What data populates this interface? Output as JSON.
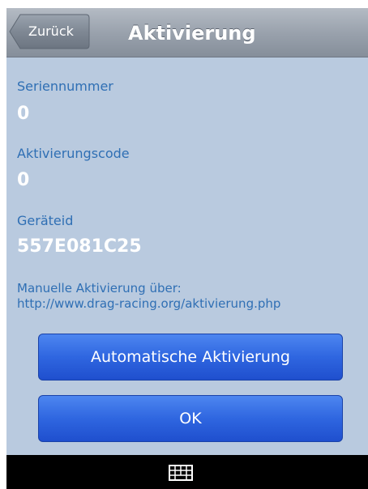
{
  "navbar": {
    "back_label": "Zurück",
    "title": "Aktivierung"
  },
  "fields": {
    "serial_label": "Seriennummer",
    "serial_value": "0",
    "activation_label": "Aktivierungscode",
    "activation_value": "0",
    "device_label": "Geräteid",
    "device_value": "557E081C25"
  },
  "info": {
    "line1": "Manuelle Aktivierung über:",
    "line2": "http://www.drag-racing.org/aktivierung.php"
  },
  "buttons": {
    "auto_label": "Automatische Aktivierung",
    "ok_label": "OK"
  },
  "bottom_bar": {
    "icon": "keyboard-icon"
  },
  "colors": {
    "background": "#b9cadf",
    "label": "#2f6fb4",
    "button": "#2f66e0",
    "navbar": "#9aa2ad"
  }
}
